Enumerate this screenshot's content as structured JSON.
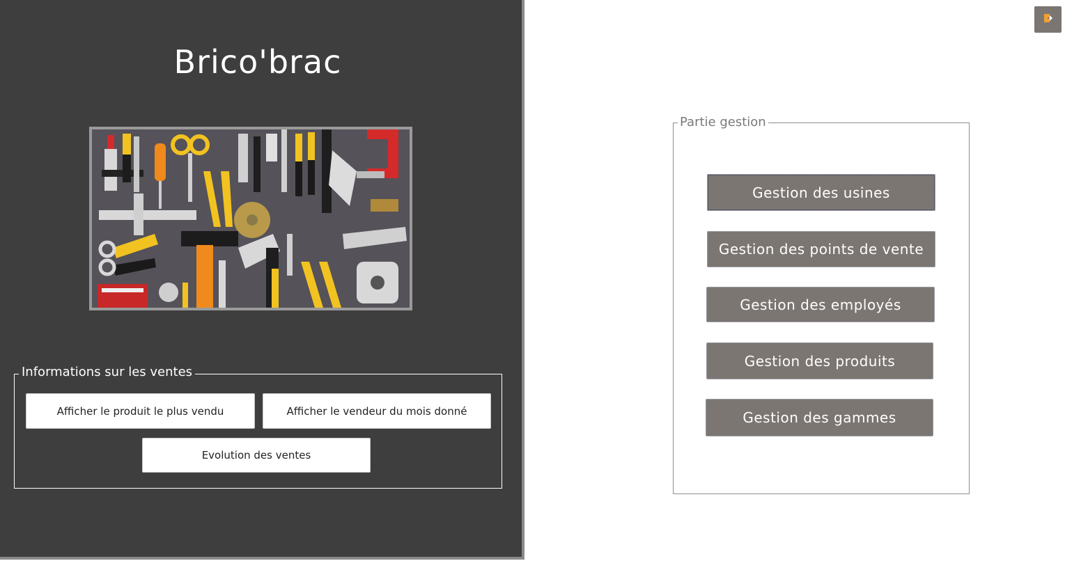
{
  "app": {
    "title": "Brico'brac"
  },
  "hero_image": {
    "description_icon": "tools-image"
  },
  "sales_info": {
    "legend": "Informations sur les ventes",
    "buttons": {
      "best_product": "Afficher le produit le plus vendu",
      "best_seller": "Afficher le vendeur du mois donné",
      "evolution": "Evolution des ventes"
    }
  },
  "management": {
    "legend": "Partie gestion",
    "buttons": {
      "factories": "Gestion des usines",
      "points_of_sale": "Gestion des points de vente",
      "employees": "Gestion des employés",
      "products": "Gestion des produits",
      "ranges": "Gestion des gammes"
    }
  },
  "corner": {
    "icon": "exit-door-icon"
  },
  "colors": {
    "left_panel_bg": "#3e3e3e",
    "gray_button": "#7b7672",
    "accent_orange": "#f0a030"
  }
}
